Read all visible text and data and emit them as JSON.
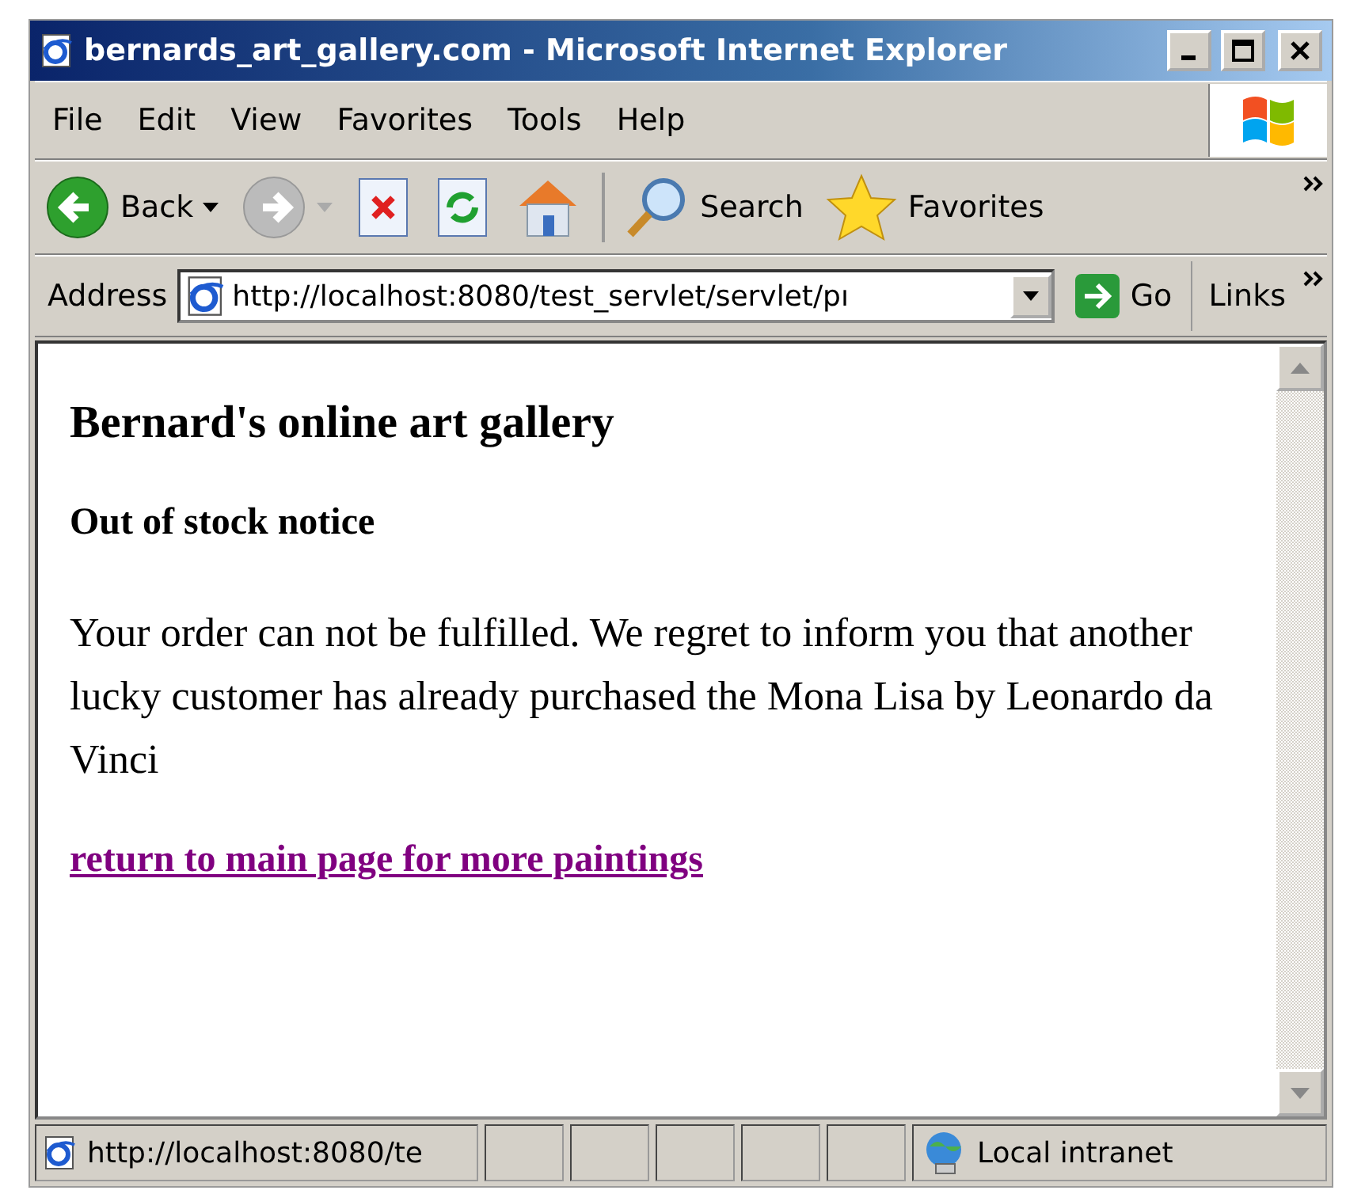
{
  "window": {
    "title": "bernards_art_gallery.com - Microsoft Internet Explorer"
  },
  "menu": [
    "File",
    "Edit",
    "View",
    "Favorites",
    "Tools",
    "Help"
  ],
  "toolbar": [
    {
      "kind": "back",
      "label": "Back",
      "disabled": false
    },
    {
      "kind": "forward",
      "disabled": true
    },
    {
      "kind": "stop"
    },
    {
      "kind": "refresh"
    },
    {
      "kind": "home"
    },
    {
      "kind": "search",
      "label": "Search"
    },
    {
      "kind": "favorites",
      "label": "Favorites"
    }
  ],
  "address": {
    "label": "Address",
    "value": "http://localhost:8080/test_servlet/servlet/pı",
    "go": "Go",
    "links": "Links"
  },
  "page": {
    "heading": "Bernard's online art gallery",
    "subheading": "Out of stock notice",
    "body": "Your order can not be fulfilled. We regret to inform you that another lucky customer has already purchased the Mona Lisa by Leonardo da Vinci",
    "link": "return to main page for more paintings",
    "link_visited": true
  },
  "status_bar": {
    "url": "http://localhost:8080/te",
    "zone": "Local intranet"
  }
}
